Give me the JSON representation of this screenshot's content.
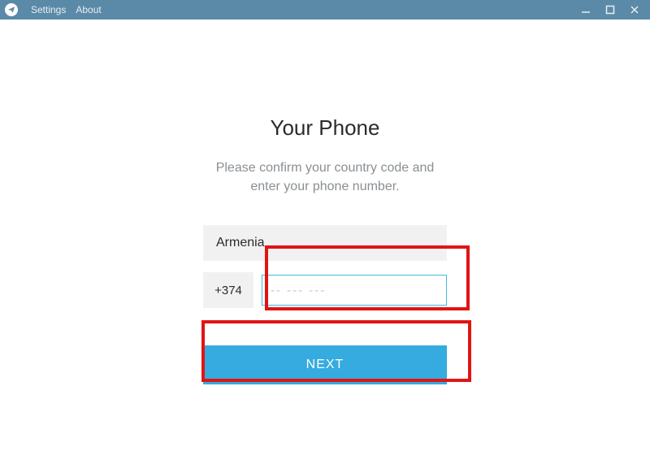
{
  "titlebar": {
    "menu": {
      "settings": "Settings",
      "about": "About"
    }
  },
  "page": {
    "heading": "Your Phone",
    "subtext_line1": "Please confirm your country code and",
    "subtext_line2": "enter your phone number."
  },
  "form": {
    "country": "Armenia",
    "country_code": "+374",
    "phone_value": "",
    "phone_placeholder": "-- --- ---",
    "next_label": "NEXT"
  }
}
